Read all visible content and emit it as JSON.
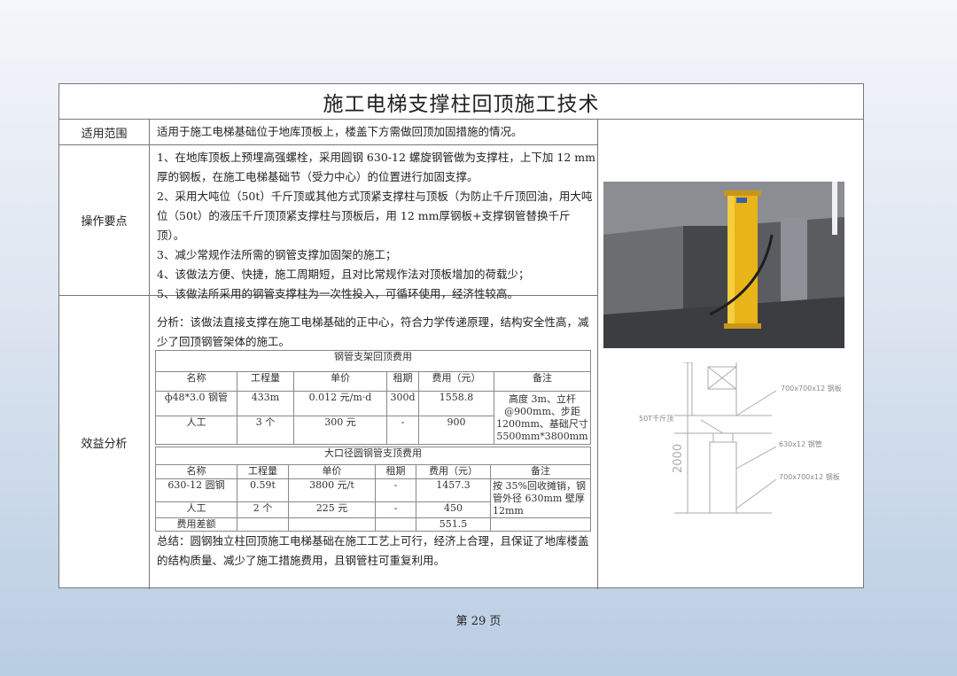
{
  "title": "施工电梯支撑柱回顶施工技术",
  "rows": {
    "scope_label": "适用范围",
    "scope_text": "适用于施工电梯基础位于地库顶板上，楼盖下方需做回顶加固措施的情况。",
    "ops_label": "操作要点",
    "ops_items": [
      "1、在地库顶板上预埋高强螺栓，采用圆钢 630-12 螺旋钢管做为支撑柱，上下加 12 mm厚的钢板，在施工电梯基础节（受力中心）的位置进行加固支撑。",
      "2、采用大吨位（50t）千斤顶或其他方式顶紧支撑柱与顶板（为防止千斤顶回油，用大吨位（50t）的液压千斤顶顶紧支撑柱与顶板后，用 12 mm厚钢板+支撑钢管替换千斤顶）。",
      "3、减少常规作法所需的钢管支撑加固架的施工；",
      "4、该做法方便、快捷，施工周期短，且对比常规作法对顶板增加的荷载少；",
      "5、该做法所采用的钢管支撑柱为一次性投入，可循环使用，经济性较高。"
    ],
    "benefit_label": "效益分析",
    "analysis_text": "分析：该做法直接支撑在施工电梯基础的正中心，符合力学传递原理，结构安全性高，减少了回顶钢管架体的施工。",
    "summary_text": "总结：圆钢独立柱回顶施工电梯基础在施工工艺上可行，经济上合理，且保证了地库楼盖的结构质量、减少了施工措施费用，且钢管柱可重复利用。"
  },
  "table1": {
    "caption": "钢管支架回顶费用",
    "headers": [
      "名称",
      "工程量",
      "单价",
      "租期",
      "费用（元）",
      "备注"
    ],
    "rows": [
      [
        "ф48*3.0 钢管",
        "433m",
        "0.012 元/m·d",
        "300d",
        "1558.8"
      ],
      [
        "人工",
        "3 个",
        "300 元",
        "-",
        "900"
      ]
    ],
    "note": "高度 3m、立杆@900mm、步距1200mm、基础尺寸5500mm*3800mm"
  },
  "table2": {
    "caption": "大口径圆钢管支顶费用",
    "headers": [
      "名称",
      "工程量",
      "单价",
      "租期",
      "费用（元）",
      "备注"
    ],
    "rows": [
      [
        "630-12 圆钢",
        "0.59t",
        "3800 元/t",
        "-",
        "1457.3"
      ],
      [
        "人工",
        "2 个",
        "225 元",
        "-",
        "450"
      ]
    ],
    "note": "按 35%回收摊销，钢管外径 630mm 壁厚 12mm",
    "diff_label": "费用差额",
    "diff_value": "551.5"
  },
  "drawing": {
    "label_top": "700x700x12 钢板",
    "label_left": "50T千斤顶",
    "label_mid": "630x12 钢管",
    "label_bottom": "700x700x12 钢板",
    "dim": "2000"
  },
  "page": "第 29 页"
}
